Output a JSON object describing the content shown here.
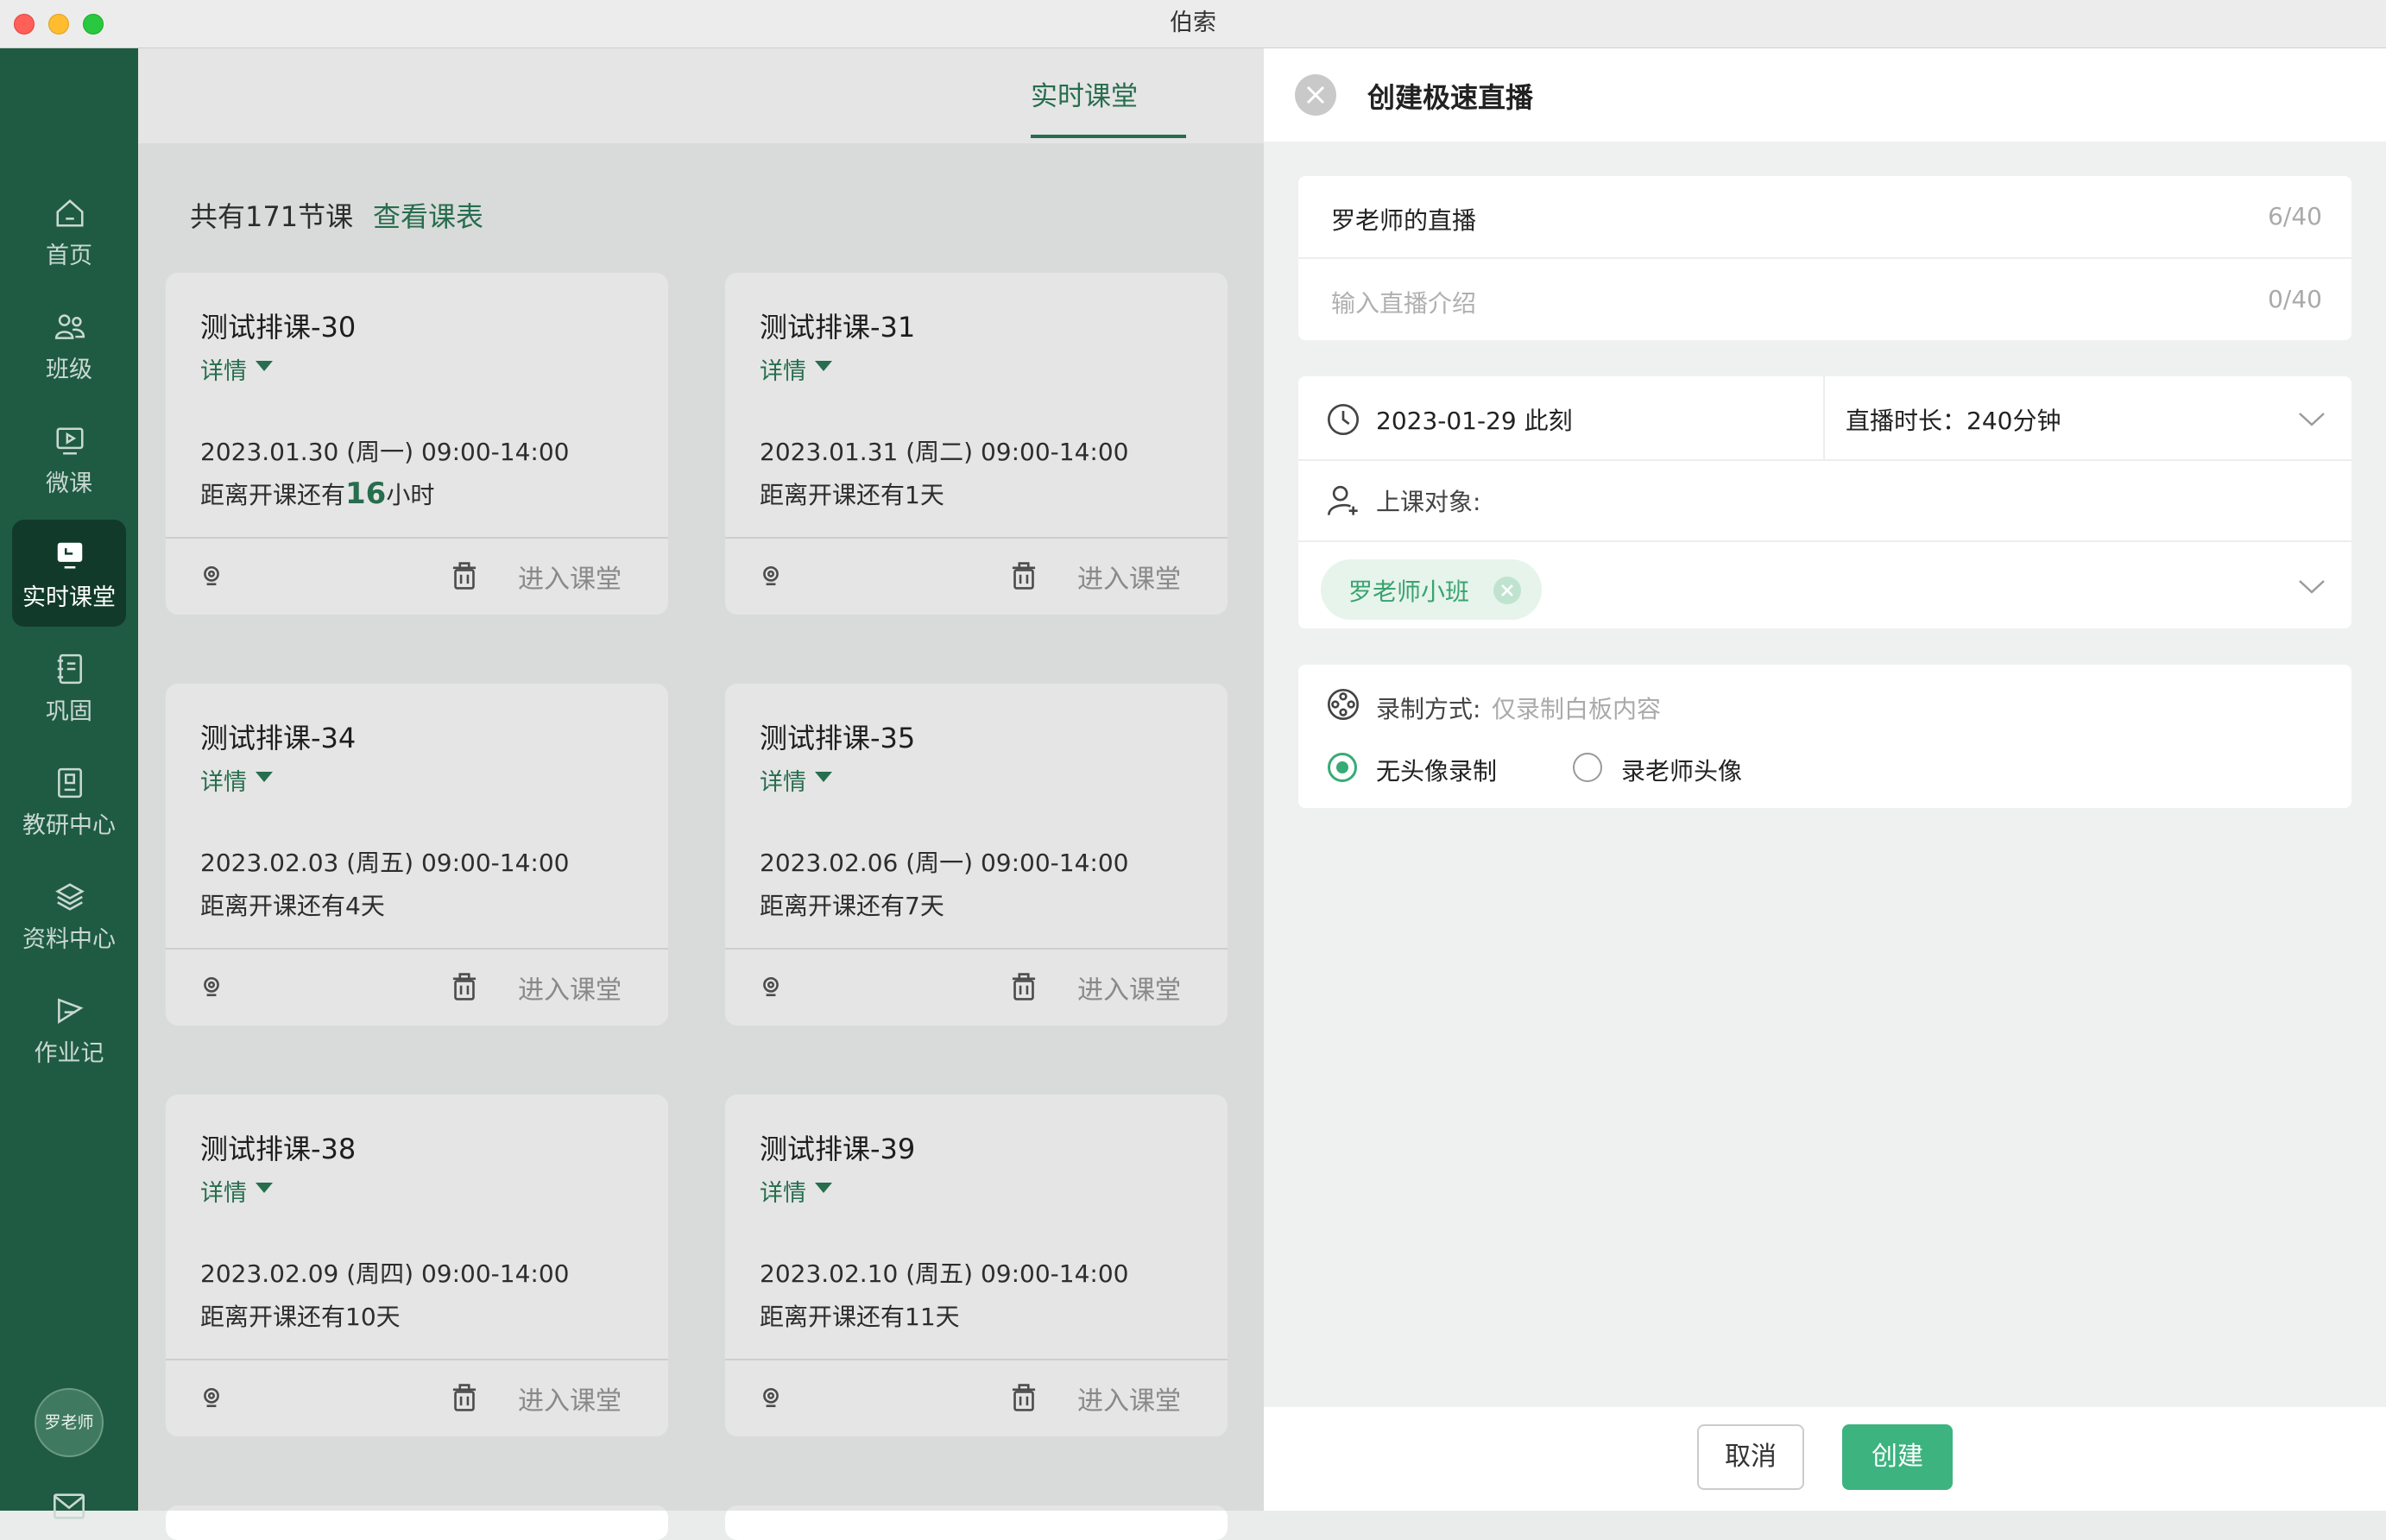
{
  "window": {
    "title": "伯索"
  },
  "sidebar": {
    "items": [
      {
        "label": "首页",
        "icon": "home-icon"
      },
      {
        "label": "班级",
        "icon": "users-icon"
      },
      {
        "label": "微课",
        "icon": "video-icon"
      },
      {
        "label": "实时课堂",
        "icon": "live-classroom-icon",
        "active": true
      },
      {
        "label": "巩固",
        "icon": "notebook-icon"
      },
      {
        "label": "教研中心",
        "icon": "research-icon"
      },
      {
        "label": "资料中心",
        "icon": "layers-icon"
      },
      {
        "label": "作业记",
        "icon": "homework-icon"
      }
    ],
    "avatar": "罗老师",
    "mail_icon": "mail-icon"
  },
  "main": {
    "tab": "实时课堂",
    "count_label": "共有171节课",
    "schedule_link": "查看课表",
    "cards": [
      {
        "title": "测试排课-30",
        "detail": "详情",
        "time": "2023.01.30 (周一) 09:00-14:00",
        "countdown_prefix": "距离开课还有",
        "countdown_value": "16",
        "countdown_suffix": "小时",
        "enter": "进入课堂"
      },
      {
        "title": "测试排课-31",
        "detail": "详情",
        "time": "2023.01.31 (周二) 09:00-14:00",
        "countdown_prefix": "距离开课还有1天",
        "countdown_value": "",
        "countdown_suffix": "",
        "enter": "进入课堂"
      },
      {
        "title": "测试排课-34",
        "detail": "详情",
        "time": "2023.02.03 (周五) 09:00-14:00",
        "countdown_prefix": "距离开课还有4天",
        "countdown_value": "",
        "countdown_suffix": "",
        "enter": "进入课堂"
      },
      {
        "title": "测试排课-35",
        "detail": "详情",
        "time": "2023.02.06 (周一) 09:00-14:00",
        "countdown_prefix": "距离开课还有7天",
        "countdown_value": "",
        "countdown_suffix": "",
        "enter": "进入课堂"
      },
      {
        "title": "测试排课-38",
        "detail": "详情",
        "time": "2023.02.09 (周四) 09:00-14:00",
        "countdown_prefix": "距离开课还有10天",
        "countdown_value": "",
        "countdown_suffix": "",
        "enter": "进入课堂"
      },
      {
        "title": "测试排课-39",
        "detail": "详情",
        "time": "2023.02.10 (周五) 09:00-14:00",
        "countdown_prefix": "距离开课还有11天",
        "countdown_value": "",
        "countdown_suffix": "",
        "enter": "进入课堂"
      }
    ]
  },
  "panel": {
    "title": "创建极速直播",
    "name_value": "罗老师的直播",
    "name_count": "6/40",
    "intro_placeholder": "输入直播介绍",
    "intro_count": "0/40",
    "date_value": "2023-01-29 此刻",
    "duration": "直播时长：240分钟",
    "audience_label": "上课对象:",
    "audience_tag": "罗老师小班",
    "record_label": "录制方式:",
    "record_hint": "仅录制白板内容",
    "record_options": [
      {
        "label": "无头像录制",
        "selected": true
      },
      {
        "label": "录老师头像",
        "selected": false
      }
    ],
    "cancel": "取消",
    "create": "创建"
  },
  "colors": {
    "sidebar": "#1f5b43",
    "accent": "#2c7a57",
    "primary_button": "#3db37f"
  }
}
